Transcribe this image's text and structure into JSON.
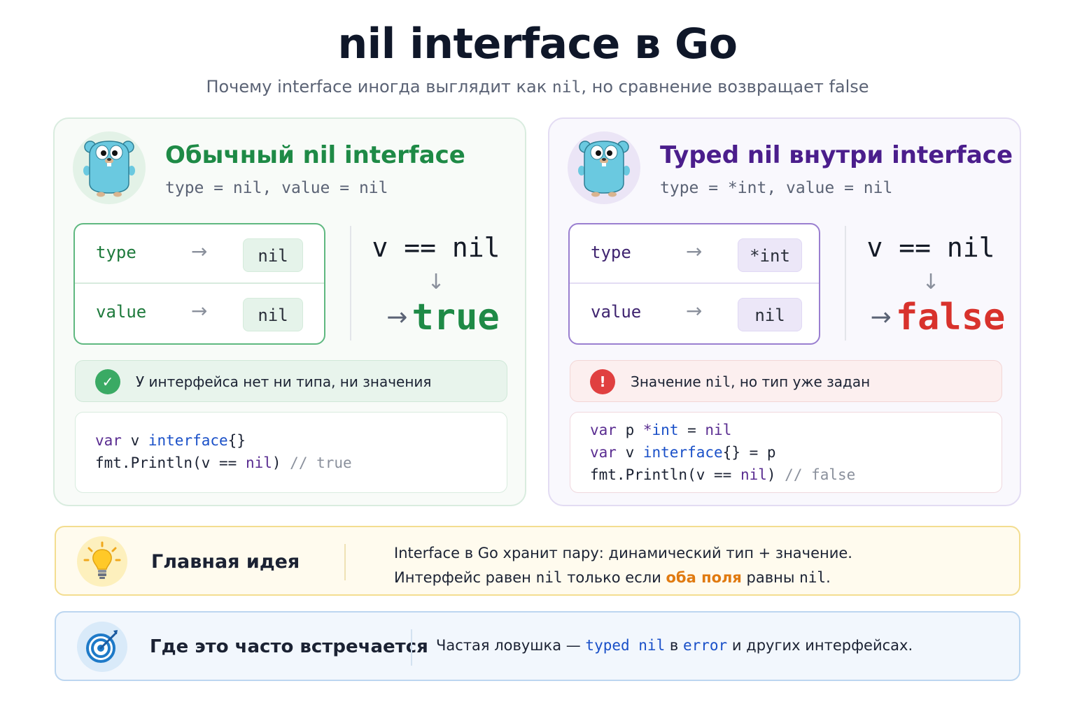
{
  "header": {
    "title": "nil interface в Go",
    "subtitle": {
      "part1": "Почему interface иногда выглядит как ",
      "mono": "nil",
      "part2": ", но сравнение возвращает false"
    }
  },
  "left": {
    "title": "Обычный nil interface",
    "subtitle": "type = nil, value = nil",
    "rows": [
      {
        "key": "type",
        "value": "nil"
      },
      {
        "key": "value",
        "value": "nil"
      }
    ],
    "arrow": "→",
    "comparison": {
      "expr": "v == nil",
      "down": "↓",
      "arrow": "→",
      "result": "true"
    },
    "status": {
      "icon": "✓",
      "text": "У интерфейса нет ни типа, ни значения"
    },
    "code": {
      "l1_kw": "var",
      "l1_name": " v ",
      "l1_type": "interface",
      "l1_rest": "{}",
      "l2_pre": "fmt.Println(v == ",
      "l2_kw": "nil",
      "l2_post": ") ",
      "l2_cm": "// true"
    }
  },
  "right": {
    "title": "Typed nil внутри interface",
    "subtitle": "type = *int, value = nil",
    "rows": [
      {
        "key": "type",
        "value": "*int"
      },
      {
        "key": "value",
        "value": "nil"
      }
    ],
    "arrow": "→",
    "comparison": {
      "expr": "v == nil",
      "down": "↓",
      "arrow": "→",
      "result": "false"
    },
    "status": {
      "icon": "!",
      "text_pre": "Значение ",
      "text_mono": "nil",
      "text_post": ", но тип уже задан"
    },
    "code": {
      "l1_kw": "var",
      "l1_name": " p ",
      "l1_star": "*",
      "l1_type": "int",
      "l1_eq": " = ",
      "l1_nil": "nil",
      "l2_kw": "var",
      "l2_name": " v ",
      "l2_type": "interface",
      "l2_rest": "{} = p",
      "l3_pre": "fmt.Println(v == ",
      "l3_kw": "nil",
      "l3_post": ") ",
      "l3_cm": "// false"
    }
  },
  "idea": {
    "title": "Главная идея",
    "line1": "Interface в Go хранит пару: динамический тип + значение.",
    "line2_pre": "Интерфейс равен ",
    "line2_mono": "nil",
    "line2_mid": " только если ",
    "line2_hl": "оба поля",
    "line2_post": " равны ",
    "line2_mono2": "nil",
    "line2_end": "."
  },
  "where": {
    "title": "Где это часто встречается",
    "text_pre": "Частая ловушка — ",
    "text_m1": "typed nil",
    "text_mid": " в ",
    "text_m2": "error",
    "text_post": " и других интерфейсах."
  },
  "colors": {
    "green": "#1e8a46",
    "purple": "#4b1e8c",
    "red": "#d8322c",
    "orange": "#e07a10",
    "blue": "#1a50c8"
  },
  "icons": {
    "mascot": "gopher-icon",
    "ok": "check-circle-icon",
    "error": "exclamation-circle-icon",
    "idea": "lightbulb-icon",
    "where": "target-icon"
  }
}
